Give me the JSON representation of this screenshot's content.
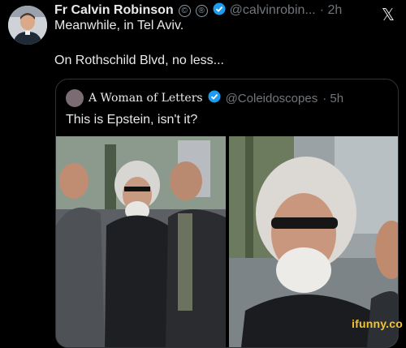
{
  "tweet": {
    "author_name": "Fr Calvin Robinson",
    "handle": "@calvinrobin...",
    "time": "· 2h",
    "line1": "Meanwhile, in Tel Aviv.",
    "line2": "On Rothschild Blvd, no less...",
    "badge1": "©",
    "badge2": "®"
  },
  "quote": {
    "author_name": "A Woman of Letters",
    "handle": "@Coleidoscopes",
    "time": "· 5h",
    "text": "This is Epstein, isn't it?"
  },
  "platform_logo": "𝕏",
  "watermark": "ifunny.co",
  "colors": {
    "background": "#000000",
    "text": "#e7e9ea",
    "muted": "#71767b",
    "verified": "#1d9bf0"
  }
}
